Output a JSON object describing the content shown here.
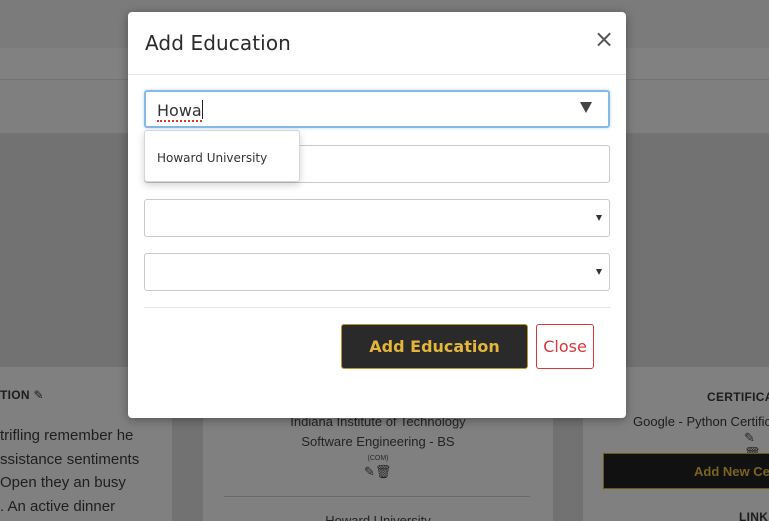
{
  "background": {
    "left_section_title": "TION",
    "left_paragraph": [
      "trifling remember he",
      "ssistance sentiments",
      "Open they an busy",
      ". An active dinner"
    ],
    "education_entry": {
      "institution": "Indiana Institute of Technology",
      "degree": "Software Engineering - BS",
      "small_note": "(COM)"
    },
    "next_institution": "Howard University",
    "right_section_title": "CERTIFICA",
    "certificate_entry": "Google - Python Certific",
    "add_certificate_label": "Add New Cer",
    "links_title": "LINKS"
  },
  "modal": {
    "title": "Add Education",
    "close_symbol": "×",
    "institution_input_value": "Howa",
    "dropdown_options": [
      "Howard University"
    ],
    "add_button_label": "Add Education",
    "close_button_label": "Close"
  },
  "colors": {
    "accent_gold": "#e3b53a",
    "danger_red": "#d9383a",
    "focus_blue": "#85b9e8",
    "button_dark": "#2a2a2a"
  }
}
